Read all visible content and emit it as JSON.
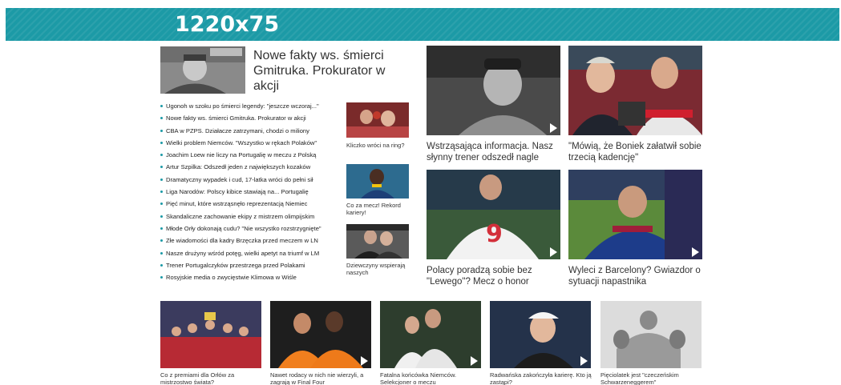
{
  "banner": {
    "text": "1220x75"
  },
  "lead": {
    "title": "Nowe fakty ws. śmierci Gmitruka. Prokurator w akcji"
  },
  "news_list": [
    "Ugonoh w szoku po śmierci legendy: \"jeszcze wczoraj...\"",
    "Nowe fakty ws. śmierci Gmitruka. Prokurator w akcji",
    "CBA w PZPS. Działacze zatrzymani, chodzi o miliony",
    "Wielki problem Niemców. \"Wszystko w rękach Polaków\"",
    "Joachim Loew nie liczy na Portugalię w meczu z Polską",
    "Artur Szpilka: Odszedł jeden z największych kozaków",
    "Dramatyczny wypadek i cud, 17-latka wróci do pełni sił",
    "Liga Narodów: Polscy kibice stawiają na... Portugalię",
    "Pięć minut, które wstrząsnęło reprezentacją Niemiec",
    "Skandaliczne zachowanie ekipy z mistrzem olimpijskim",
    "Młode Orły dokonają cudu? \"Nie wszystko rozstrzygnięte\"",
    "Złe wiadomości dla kadry Brzęczka przed meczem w LN",
    "Nasze drużyny wśród potęg, wielki apetyt na triumf w LM",
    "Trener Portugalczyków przestrzega przed Polakami",
    "Rosyjskie media o zwycięstwie Klimowa w Wiśle"
  ],
  "side_items": [
    {
      "caption": "Kliczko wróci na ring?"
    },
    {
      "caption": "Co za mecz! Rekord kariery!"
    },
    {
      "caption": "Dziewczyny wspierają naszych"
    }
  ],
  "grid_items": [
    {
      "caption": "Wstrząsająca informacja. Nasz słynny trener odszedł nagle"
    },
    {
      "caption": "\"Mówią, że Boniek załatwił sobie trzecią kadencję\""
    },
    {
      "caption": "Polacy poradzą sobie bez \"Lewego\"? Mecz o honor"
    },
    {
      "caption": "Wyleci z Barcelony? Gwiazdor o sytuacji napastnika"
    }
  ],
  "bottom_items": [
    {
      "caption": "Co z premiami dla Orłów za mistrzostwo świata?"
    },
    {
      "caption": "Nawet rodacy w nich nie wierzyli, a zagrają w Final Four"
    },
    {
      "caption": "Fatalna końcówka Niemców. Selekcjoner o meczu"
    },
    {
      "caption": "Radwańska zakończyła karierę. Kto ją zastąpi?"
    },
    {
      "caption": "Pięciolatek jest \"czeczeńskim Schwarzeneggerem\""
    }
  ],
  "colors": {
    "banner": "#1c9aa6",
    "bullet": "#1c9aa6"
  }
}
